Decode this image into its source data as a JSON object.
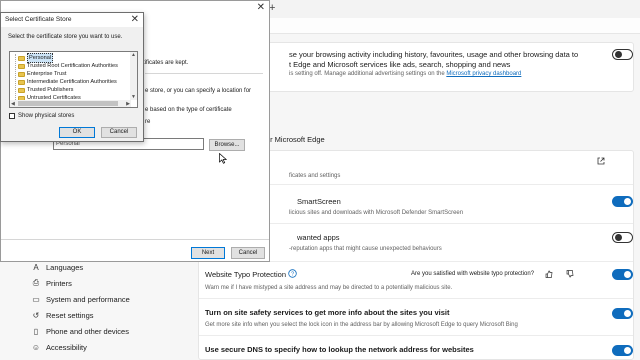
{
  "browser": {
    "new_tab_symbol": "+"
  },
  "settings": {
    "activity_card": {
      "title_line1": "se your browsing activity including history, favourites, usage and other browsing data to",
      "title_line2": "t Edge and Microsoft services like ads, search, shopping and news",
      "desc_prefix": "is setting off. Manage additional advertising settings on the",
      "desc_link": "Microsoft privacy dashboard",
      "toggle": "off"
    },
    "section_heading": "s for Microsoft Edge",
    "certs_row": {
      "desc": "ficates and settings"
    },
    "smartscreen": {
      "title": "SmartScreen",
      "desc": "licious sites and downloads with Microsoft Defender SmartScreen",
      "toggle": "on"
    },
    "unwanted_apps": {
      "title": "wanted apps",
      "desc": "-reputation apps that might cause unexpected behaviours",
      "toggle": "off"
    },
    "typo": {
      "title": "Website Typo Protection",
      "feedback_question": "Are you satisfied with website typo protection?",
      "desc": "Warn me if I have mistyped a site address and may be directed to a potentially malicious site.",
      "toggle": "on"
    },
    "site_safety": {
      "title": "Turn on site safety services to get more info about the sites you visit",
      "desc": "Get more site info when you select the lock icon in the address bar by allowing Microsoft Edge to query Microsoft Bing",
      "toggle": "on"
    },
    "secure_dns": {
      "title": "Use secure DNS to specify how to lookup the network address for websites",
      "toggle": "on"
    },
    "accent_color": "#0f6cbd"
  },
  "sidebar": {
    "items": [
      {
        "label": "Languages",
        "icon": "languages-icon"
      },
      {
        "label": "Printers",
        "icon": "printer-icon"
      },
      {
        "label": "System and performance",
        "icon": "system-icon"
      },
      {
        "label": "Reset settings",
        "icon": "reset-icon"
      },
      {
        "label": "Phone and other devices",
        "icon": "phone-icon"
      },
      {
        "label": "Accessibility",
        "icon": "accessibility-icon"
      }
    ]
  },
  "wizard": {
    "line_kept": "rtificates are kept.",
    "line_specify": "e store, or you can specify a location for",
    "line_based": "e based on the type of certificate",
    "line_re": "re",
    "path_value": "Personal",
    "browse_label": "Browse...",
    "next_label": "Next",
    "cancel_label": "Cancel"
  },
  "dialog": {
    "title": "Select Certificate Store",
    "instruction": "Select the certificate store you want to use.",
    "stores": [
      "Personal",
      "Trusted Root Certification Authorities",
      "Enterprise Trust",
      "Intermediate Certification Authorities",
      "Trusted Publishers",
      "Untrusted Certificates"
    ],
    "selected_store": "Personal",
    "show_physical_label": "Show physical stores",
    "ok_label": "OK",
    "cancel_label": "Cancel"
  }
}
